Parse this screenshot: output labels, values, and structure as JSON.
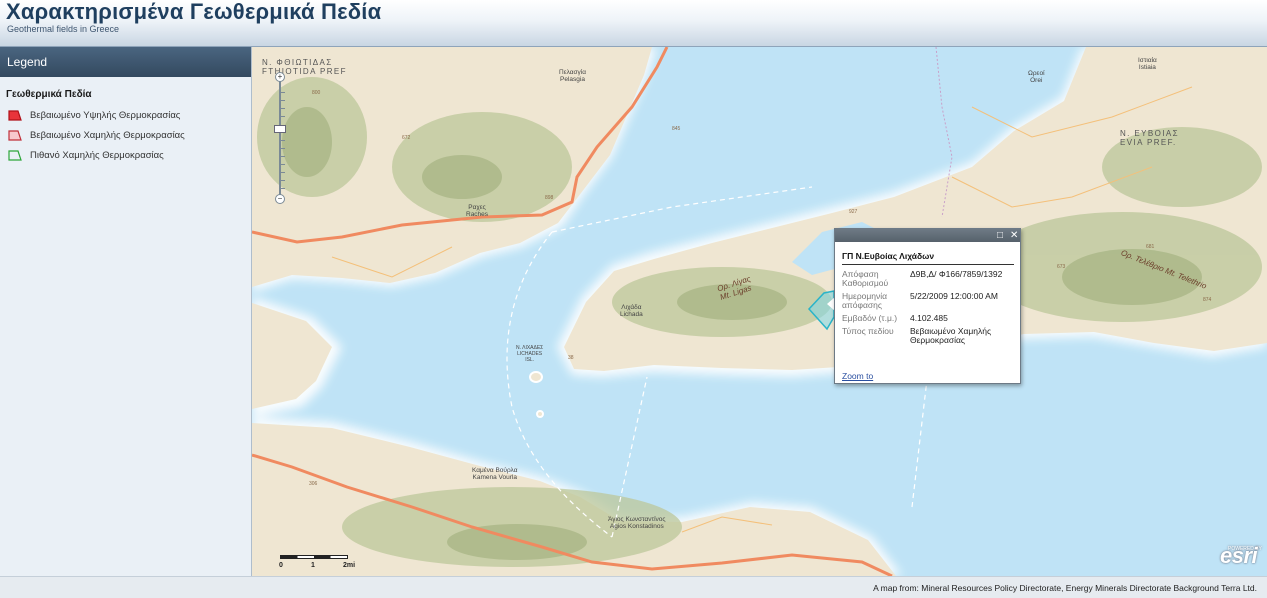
{
  "header": {
    "title": "Χαρακτηρισμένα Γεωθερμικά Πεδία",
    "subtitle": "Geothermal fields in Greece"
  },
  "sidebar": {
    "legend_title": "Legend",
    "layer_title": "Γεωθερμικά Πεδία",
    "items": [
      {
        "label": "Βεβαιωμένο Υψηλής Θερμοκρασίας",
        "fill": "#e8343a",
        "stroke": "#b01018"
      },
      {
        "label": "Βεβαιωμένο Χαμηλής Θερμοκρασίας",
        "fill": "#f7c8cd",
        "stroke": "#c0303a"
      },
      {
        "label": "Πιθανό Χαμηλής Θερμοκρασίας",
        "fill": "#eaf0f6",
        "stroke": "#2da63a"
      }
    ]
  },
  "map": {
    "zoom_plus": "+",
    "zoom_minus": "−",
    "places": {
      "pelasgia": "Πελασγία\nPelasgia",
      "raches": "Ραχες\nRaches",
      "lichada": "Λιχάδα\nLichada",
      "lichades": "Ν. ΛΙΧΑΔΕΣ\nLICHADES\nISL.",
      "oreoi": "Ωρεοί\nOrei",
      "istiaia": "Ιστιαία\nIstiaia",
      "kamena_vourla": "Καμένα Βούρλα\nKamena Vourla",
      "agios_konstantinos": "Άγιος Κωνσταντίνος\nAgios Konstadinos"
    },
    "prefectures": {
      "fthiotida": "Ν. ΦΘΙΩΤΙΔΑΣ\nFTHIOTIDA PREF",
      "evia": "Ν. ΕΥΒΟΙΑΣ\nEVIA PREF."
    },
    "mountains": {
      "ligas": "Ορ. Λίγας\nMt. Ligas",
      "telethrio": "Ορ. Τελέθριο Mt. Telethrio"
    },
    "peaks": [
      "800",
      "672",
      "845",
      "898",
      "927",
      "38",
      "306",
      "681",
      "673",
      "874"
    ],
    "scale": {
      "zero": "0",
      "one": "1",
      "two": "2mi"
    },
    "esri_powered": "POWERED BY",
    "esri": "esri"
  },
  "popup": {
    "title": "ΓΠ Ν.Ευβοίας Λιχάδων",
    "fields": [
      {
        "key": "Απόφαση Καθορισμού",
        "value": "Δ9Β,Δ/ Φ166/7859/1392"
      },
      {
        "key": "Ημερομηνία απόφασης",
        "value": "5/22/2009 12:00:00 AM"
      },
      {
        "key": "Εμβαδόν (τ.μ.)",
        "value": "4.102.485"
      },
      {
        "key": "Τύπος πεδίου",
        "value": "Βεβαιωμένο Χαμηλής Θερμοκρασίας"
      }
    ],
    "zoom_to": "Zoom to",
    "maximize": "□",
    "close": "✕"
  },
  "footer": {
    "credits": "A map from: Mineral Resources Policy Directorate, Energy Minerals Directorate Background Terra Ltd."
  }
}
